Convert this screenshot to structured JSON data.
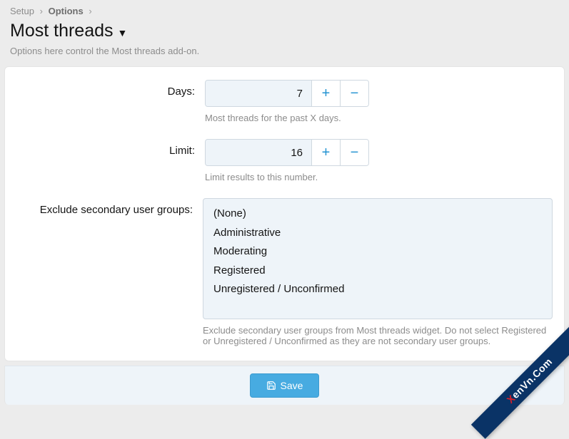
{
  "breadcrumbs": {
    "setup": "Setup",
    "options": "Options"
  },
  "page": {
    "title": "Most threads",
    "description": "Options here control the Most threads add-on."
  },
  "fields": {
    "days": {
      "label": "Days:",
      "value": "7",
      "help": "Most threads for the past X days."
    },
    "limit": {
      "label": "Limit:",
      "value": "16",
      "help": "Limit results to this number."
    },
    "exclude": {
      "label": "Exclude secondary user groups:",
      "options": [
        "(None)",
        "Administrative",
        "Moderating",
        "Registered",
        "Unregistered / Unconfirmed"
      ],
      "help": "Exclude secondary user groups from Most threads widget. Do not select Registered or Unregistered / Unconfirmed as they are not secondary user groups."
    }
  },
  "buttons": {
    "save": "Save",
    "plus": "+",
    "minus": "−"
  },
  "watermark": {
    "prefix": "X",
    "rest": "enVn.Com"
  }
}
